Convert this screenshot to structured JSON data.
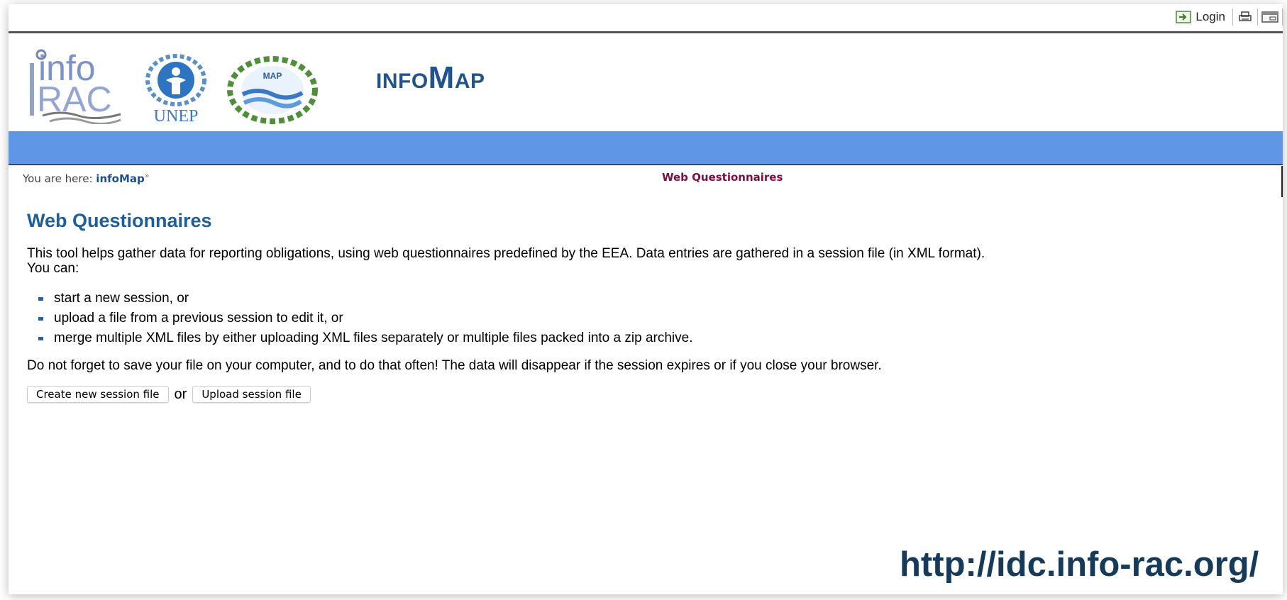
{
  "topbar": {
    "login_label": "Login"
  },
  "header": {
    "logo_info_text": "info",
    "logo_rac_text": "RAC",
    "logo_unep_text": "UNEP",
    "logo_map_text": "MAP",
    "site_title_prefix": "INFO",
    "site_title_initial": "M",
    "site_title_suffix": "AP"
  },
  "breadcrumb": {
    "label": "You are here:",
    "home": "infoMap",
    "separator": "»",
    "current": "Web Questionnaires"
  },
  "main": {
    "title": "Web Questionnaires",
    "intro_line1": "This tool helps gather data for reporting obligations, using web questionnaires predefined by the EEA. Data entries are gathered in a session file (in XML format).",
    "intro_line2": "You can:",
    "options": [
      "start a new session, or",
      "upload a file from a previous session to edit it, or",
      "merge multiple XML files by either uploading XML files separately or multiple files packed into a zip archive."
    ],
    "warning": "Do not forget to save your file on your computer, and to do that often! The data will disappear if the session expires or if you close your browser.",
    "create_button": "Create new session file",
    "or_text": "or",
    "upload_button": "Upload session file"
  },
  "footer_url": "http://idc.info-rac.org/",
  "colors": {
    "bluebar": "#6096e6",
    "title_blue": "#1f5e96",
    "current_crumb": "#7a1040"
  },
  "icons": [
    "login-icon",
    "print-icon",
    "fullscreen-icon"
  ]
}
